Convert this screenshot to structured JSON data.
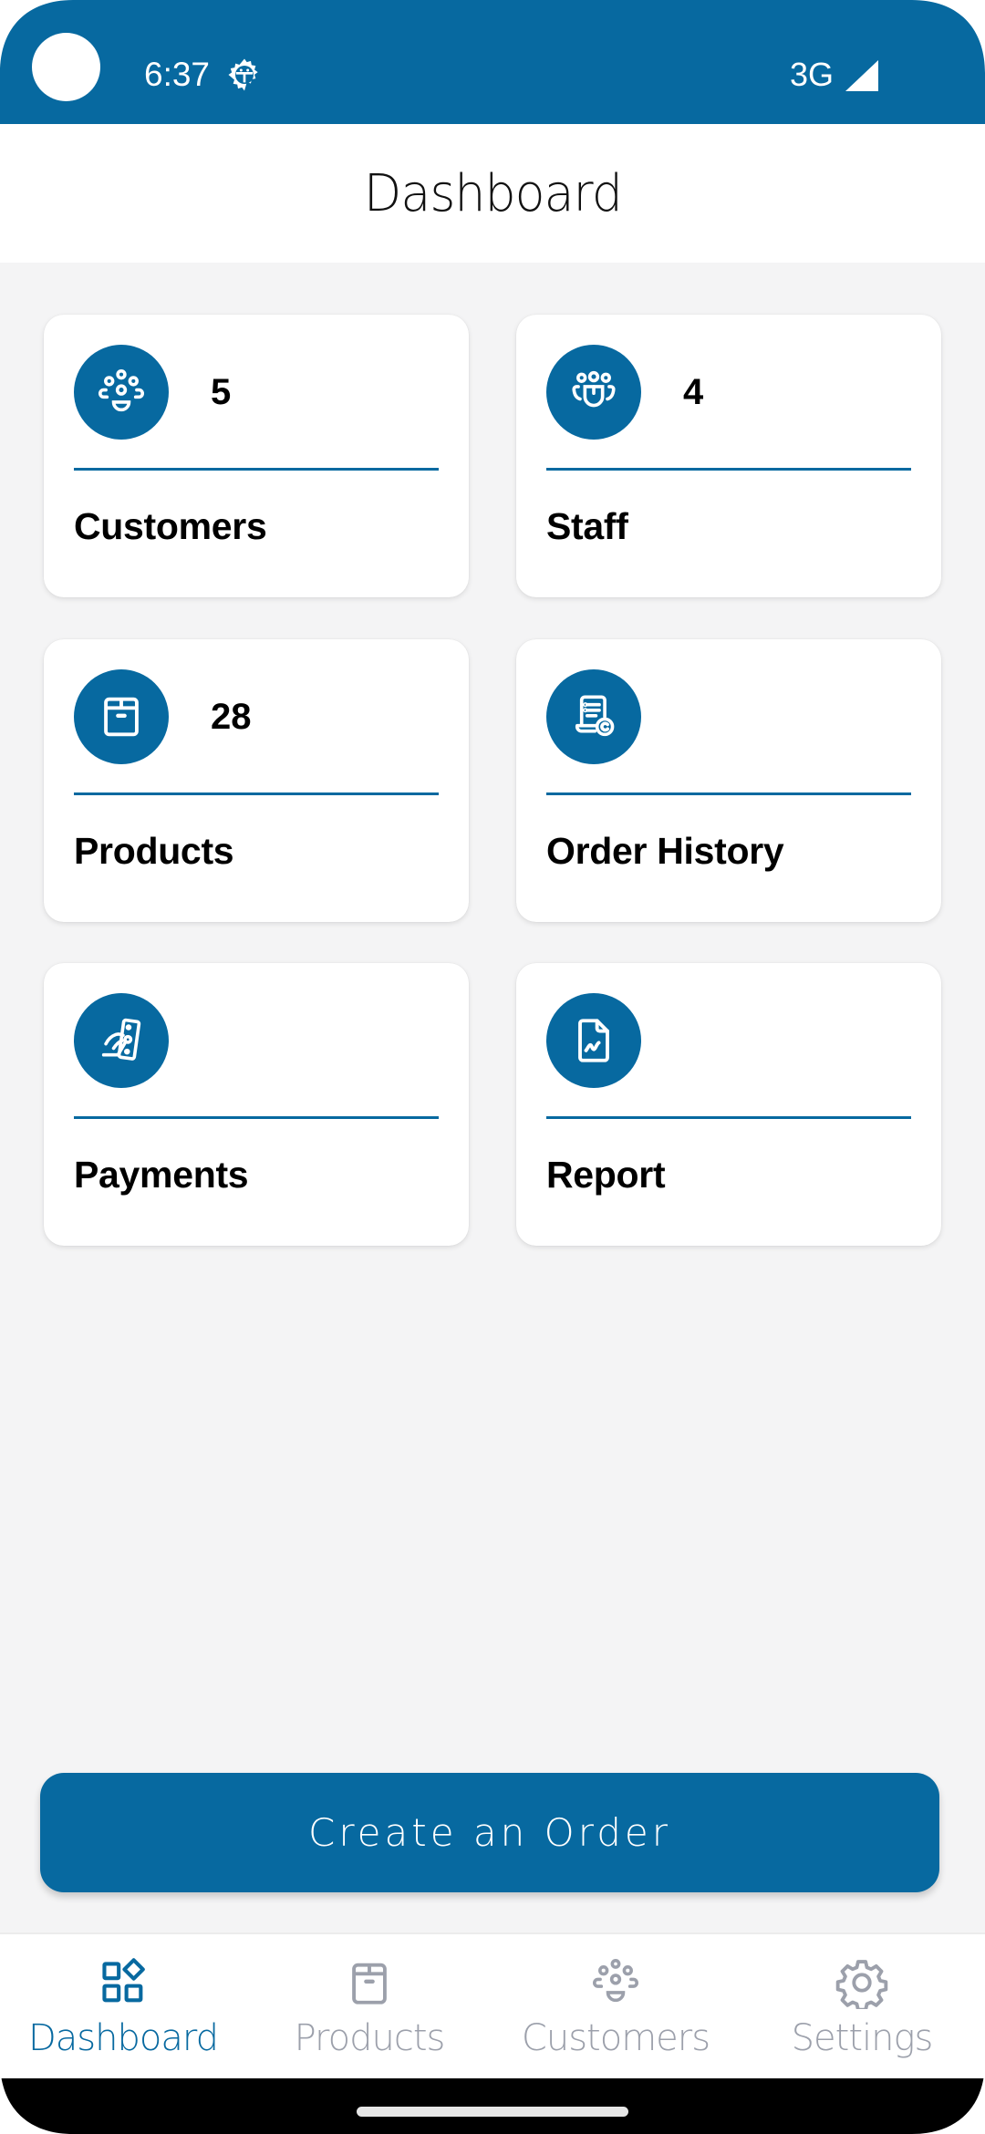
{
  "status_bar": {
    "time": "6:37",
    "network": "3G",
    "icons": [
      "camera-cutout",
      "system-gear-icon",
      "signal-icon"
    ]
  },
  "header": {
    "title": "Dashboard"
  },
  "cards": [
    {
      "id": "customers",
      "label": "Customers",
      "count": "5",
      "icon": "customers-group-icon"
    },
    {
      "id": "staff",
      "label": "Staff",
      "count": "4",
      "icon": "staff-group-icon"
    },
    {
      "id": "products",
      "label": "Products",
      "count": "28",
      "icon": "box-icon"
    },
    {
      "id": "order-history",
      "label": "Order History",
      "count": "",
      "icon": "receipt-history-icon"
    },
    {
      "id": "payments",
      "label": "Payments",
      "count": "",
      "icon": "payment-hand-icon"
    },
    {
      "id": "report",
      "label": "Report",
      "count": "",
      "icon": "report-chart-icon"
    }
  ],
  "primary_action": {
    "label": "Create an Order"
  },
  "bottom_nav": {
    "active": "Dashboard",
    "items": [
      {
        "label": "Dashboard",
        "icon": "dashboard-grid-icon"
      },
      {
        "label": "Products",
        "icon": "box-icon"
      },
      {
        "label": "Customers",
        "icon": "customers-group-icon"
      },
      {
        "label": "Settings",
        "icon": "gear-icon"
      }
    ]
  },
  "colors": {
    "brand": "#0769a0",
    "background": "#f4f4f5",
    "inactive_nav": "#9ca0ab",
    "card": "#ffffff"
  }
}
